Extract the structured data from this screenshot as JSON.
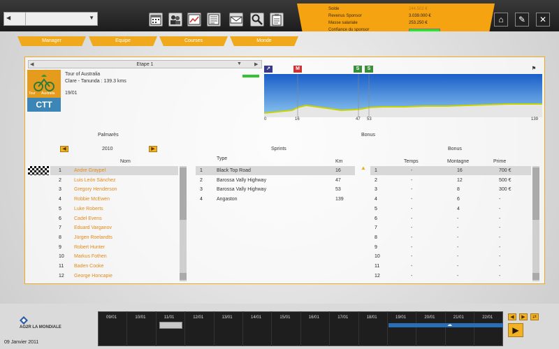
{
  "topbar": {
    "selector_value": "",
    "finance": {
      "solde_label": "Solde",
      "solde_value": "244.502 €",
      "revenus_label": "Revenus Sponsor",
      "revenus_value": "3.039.000 €",
      "masse_label": "Masse salariale",
      "masse_value": "253.250 €",
      "confiance_label": "Confiance du sponsor"
    },
    "confidence_level": 1.0,
    "colors": {
      "accent": "#f0a81c",
      "confidence": "#2ee52e"
    }
  },
  "nav": [
    "Manager",
    "Equipe",
    "Courses",
    "Monde"
  ],
  "race": {
    "stage_label": "Etape 1",
    "name": "Tour of Australia",
    "route": "Clare - Tanunda : 139.3 kms",
    "date": "19/01",
    "logo_top_left": "Tour",
    "logo_top_right": "Australia",
    "logo_bottom": "CTT",
    "markers": [
      "M",
      "S",
      "S"
    ],
    "km_ticks": [
      "0",
      "16",
      "47",
      "53",
      "139"
    ]
  },
  "palmares": {
    "title": "Palmarès",
    "year": "2010",
    "col_nom": "Nom",
    "rows": [
      {
        "n": "1",
        "nom": "Andre Graypel"
      },
      {
        "n": "2",
        "nom": "Luis León Sánchez"
      },
      {
        "n": "3",
        "nom": "Gregory Henderson"
      },
      {
        "n": "4",
        "nom": "Robbie McEwen"
      },
      {
        "n": "5",
        "nom": "Luke Roberts"
      },
      {
        "n": "6",
        "nom": "Cadel Evens"
      },
      {
        "n": "7",
        "nom": "Eduard Varganov"
      },
      {
        "n": "8",
        "nom": "Jürgen Roelandts"
      },
      {
        "n": "9",
        "nom": "Robert Hunter"
      },
      {
        "n": "10",
        "nom": "Markus Fothen"
      },
      {
        "n": "11",
        "nom": "Baden Cooke"
      },
      {
        "n": "12",
        "nom": "George Honcapie"
      }
    ]
  },
  "sprints": {
    "title": "Sprints",
    "col_type": "Type",
    "col_km": "Km",
    "rows": [
      {
        "n": "1",
        "type": "Black Top Road",
        "km": "16"
      },
      {
        "n": "2",
        "type": "Barossa Vally Highway",
        "km": "47"
      },
      {
        "n": "3",
        "type": "Barossa Vally Highway",
        "km": "53"
      },
      {
        "n": "4",
        "type": "Angaston",
        "km": "139"
      }
    ]
  },
  "bonus": {
    "title": "Bonus",
    "subtitle": "Bonus",
    "col_temps": "Temps",
    "col_montagne": "Montagne",
    "col_prime": "Prime",
    "rows": [
      {
        "n": "1",
        "temps": "-",
        "montagne": "16",
        "prime": "700 €"
      },
      {
        "n": "2",
        "temps": "-",
        "montagne": "12",
        "prime": "500 €"
      },
      {
        "n": "3",
        "temps": "-",
        "montagne": "8",
        "prime": "300 €"
      },
      {
        "n": "4",
        "temps": "-",
        "montagne": "6",
        "prime": "-"
      },
      {
        "n": "5",
        "temps": "-",
        "montagne": "4",
        "prime": "-"
      },
      {
        "n": "6",
        "temps": "-",
        "montagne": "-",
        "prime": "-"
      },
      {
        "n": "7",
        "temps": "-",
        "montagne": "-",
        "prime": "-"
      },
      {
        "n": "8",
        "temps": "-",
        "montagne": "-",
        "prime": "-"
      },
      {
        "n": "9",
        "temps": "-",
        "montagne": "-",
        "prime": "-"
      },
      {
        "n": "10",
        "temps": "-",
        "montagne": "-",
        "prime": "-"
      },
      {
        "n": "11",
        "temps": "-",
        "montagne": "-",
        "prime": "-"
      },
      {
        "n": "12",
        "temps": "-",
        "montagne": "-",
        "prime": "-"
      }
    ]
  },
  "footer": {
    "team_logo_text": "AG2R LA MONDIALE",
    "current_date": "09 Janvier 2011",
    "timeline_days": [
      "09/01",
      "10/01",
      "11/01",
      "12/01",
      "13/01",
      "14/01",
      "15/01",
      "16/01",
      "17/01",
      "18/01",
      "19/01",
      "20/01",
      "21/01",
      "22/01"
    ]
  }
}
